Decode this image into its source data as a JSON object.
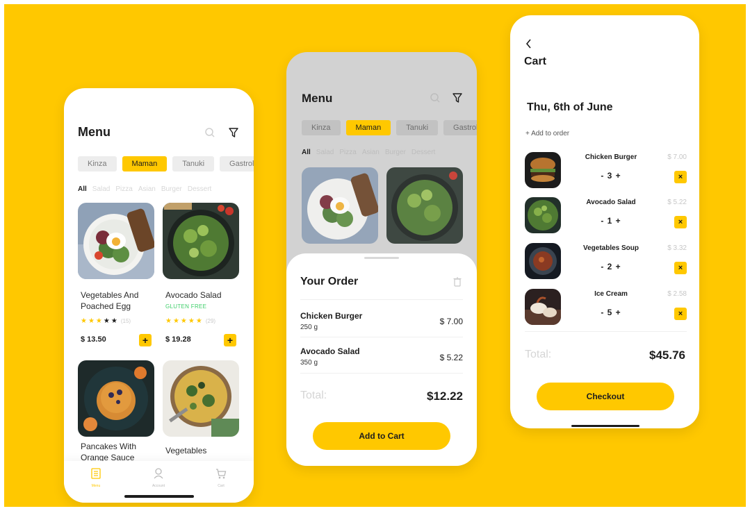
{
  "colors": {
    "brand": "#FFC800",
    "text": "#1c1c1c",
    "muted": "#c8c8c8",
    "gluten": "#3fcf6a"
  },
  "menu": {
    "title": "Menu",
    "restaurants": [
      "Kinza",
      "Maman",
      "Tanuki",
      "Gastrol"
    ],
    "active_restaurant": "Maman",
    "categories": [
      "All",
      "Salad",
      "Pizza",
      "Asian",
      "Burger",
      "Dessert"
    ],
    "active_category": "All",
    "items": [
      {
        "name": "Vegetables And Poached Egg",
        "rating": 3,
        "reviews": "(15)",
        "price": "$ 13.50",
        "image": "egg-bowl"
      },
      {
        "name": "Avocado Salad",
        "tag": "GLUTEN FREE",
        "rating": 5,
        "reviews": "(29)",
        "price": "$ 19.28",
        "image": "salad-pan"
      },
      {
        "name": "Pancakes With Orange Sauce",
        "image": "pancakes"
      },
      {
        "name": "Vegetables",
        "image": "veg-bowl"
      }
    ],
    "nav": [
      {
        "label": "Menu",
        "icon": "menu-icon"
      },
      {
        "label": "Account",
        "icon": "account-icon"
      },
      {
        "label": "Cart",
        "icon": "cart-icon"
      }
    ]
  },
  "order": {
    "title": "Your Order",
    "items": [
      {
        "name": "Chicken Burger",
        "weight": "250 g",
        "price": "$ 7.00"
      },
      {
        "name": "Avocado Salad",
        "weight": "350 g",
        "price": "$ 5.22"
      }
    ],
    "total_label": "Total:",
    "total": "$12.22",
    "cta": "Add to Cart"
  },
  "cart": {
    "title": "Cart",
    "date": "Thu, 6th of June",
    "add_link": "+ Add to order",
    "items": [
      {
        "name": "Chicken Burger",
        "qty": "3",
        "price": "$ 7.00",
        "image": "burger"
      },
      {
        "name": "Avocado Salad",
        "qty": "1",
        "price": "$ 5.22",
        "image": "salad-pan"
      },
      {
        "name": "Vegetables Soup",
        "qty": "2",
        "price": "$ 3.32",
        "image": "soup"
      },
      {
        "name": "Ice Cream",
        "qty": "5",
        "price": "$ 2.58",
        "image": "ice-cream"
      }
    ],
    "total_label": "Total:",
    "total": "$45.76",
    "cta": "Checkout"
  }
}
